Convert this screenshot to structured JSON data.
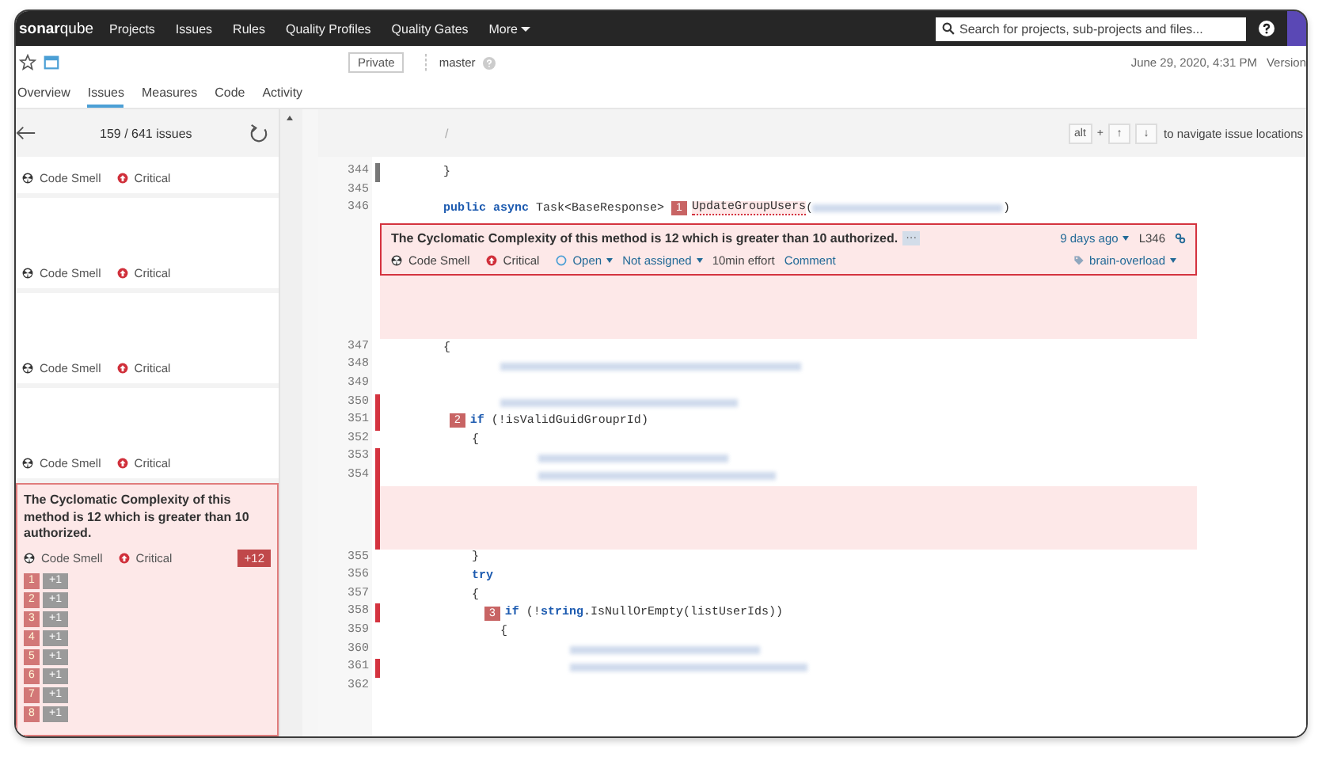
{
  "nav": {
    "logo": "**sonar**qube",
    "items": [
      "Projects",
      "Issues",
      "Rules",
      "Quality Profiles",
      "Quality Gates"
    ],
    "more": "More",
    "search_placeholder": "Search for projects, sub-projects and files..."
  },
  "project": {
    "visibility": "Private",
    "branch": "master",
    "date": "June 29, 2020, 4:31 PM",
    "version": "Version"
  },
  "tabs": [
    {
      "label": "Overview",
      "selected": false
    },
    {
      "label": "Issues",
      "selected": true
    },
    {
      "label": "Measures",
      "selected": false
    },
    {
      "label": "Code",
      "selected": false
    },
    {
      "label": "Activity",
      "selected": false
    }
  ],
  "issues_panel": {
    "count": "159 / 641 issues",
    "issues": [
      {
        "type": "Code Smell",
        "severity": "Critical",
        "selected": false
      },
      {
        "type": "Code Smell",
        "severity": "Critical",
        "selected": false
      },
      {
        "type": "Code Smell",
        "severity": "Critical",
        "selected": false
      },
      {
        "type": "Code Smell",
        "severity": "Critical",
        "selected": false
      },
      {
        "type": "Code Smell",
        "severity": "Critical",
        "selected": true,
        "message": "The Cyclomatic Complexity of this method is 12 which is greater than 10 authorized.",
        "total": "+12",
        "locations": [
          {
            "index": "1",
            "value": "+1"
          },
          {
            "index": "2",
            "value": "+1"
          },
          {
            "index": "3",
            "value": "+1"
          },
          {
            "index": "4",
            "value": "+1"
          },
          {
            "index": "5",
            "value": "+1"
          },
          {
            "index": "6",
            "value": "+1"
          },
          {
            "index": "7",
            "value": "+1"
          },
          {
            "index": "8",
            "value": "+1"
          }
        ]
      }
    ]
  },
  "code_viewer": {
    "path": "/",
    "keys": [
      "alt",
      "+",
      "↑",
      "↓"
    ],
    "hint": "to navigate issue locations",
    "lines": [
      {
        "kind": "code",
        "number": "344",
        "changed": true,
        "flagged": false,
        "tokens": [
          {
            "kind": "plain",
            "t": "        }"
          }
        ]
      },
      {
        "kind": "code",
        "number": "345",
        "changed": false,
        "flagged": false
      },
      {
        "kind": "code",
        "number": "346",
        "changed": false,
        "flagged": false,
        "tokens": [
          {
            "kind": "keyword",
            "t": "        public async"
          },
          {
            "kind": "plain",
            "t": " Task<BaseResponse> "
          },
          {
            "kind": "location",
            "t": "1"
          },
          {
            "kind": "issue",
            "t": "UpdateGroupUsers"
          },
          {
            "kind": "plain",
            "t": "("
          },
          {
            "kind": "blur"
          },
          {
            "kind": "plain",
            "t": ")"
          }
        ]
      },
      {
        "kind": "issue",
        "message": "The Cyclomatic Complexity of this method is 12 which is greater than 10 authorized.",
        "more": "···",
        "age": "9 days ago",
        "line": "L346",
        "type": "Code Smell",
        "severity": "Critical",
        "status": "Open",
        "assignee": "Not assigned",
        "effort": "10min effort",
        "comment": "Comment",
        "tag": "brain-overload"
      },
      {
        "kind": "gap",
        "flagged": false
      },
      {
        "kind": "code",
        "number": "347",
        "changed": false,
        "flagged": false,
        "tokens": [
          {
            "kind": "plain",
            "t": "        {"
          }
        ]
      },
      {
        "kind": "blurred",
        "number": "348",
        "changed": false,
        "flagged": false
      },
      {
        "kind": "code",
        "number": "349",
        "changed": false,
        "flagged": false
      },
      {
        "kind": "blurred",
        "number": "350",
        "changed": false,
        "flagged": true
      },
      {
        "kind": "code",
        "number": "351",
        "changed": false,
        "flagged": true,
        "tokens": [
          {
            "kind": "location",
            "t": "2"
          },
          {
            "kind": "keyword",
            "t": "if"
          },
          {
            "kind": "plain",
            "t": " (!isValidGuidGrouprId)"
          }
        ]
      },
      {
        "kind": "code",
        "number": "352",
        "changed": false,
        "flagged": false,
        "tokens": [
          {
            "kind": "plain",
            "t": "            {"
          }
        ]
      },
      {
        "kind": "blurred",
        "number": "353",
        "changed": false,
        "flagged": true
      },
      {
        "kind": "blurred",
        "number": "354",
        "changed": false,
        "flagged": true
      },
      {
        "kind": "gap",
        "flagged": true
      },
      {
        "kind": "code",
        "number": "355",
        "changed": false,
        "flagged": false,
        "tokens": [
          {
            "kind": "plain",
            "t": "            }"
          }
        ]
      },
      {
        "kind": "code",
        "number": "356",
        "changed": false,
        "flagged": false,
        "tokens": [
          {
            "kind": "keyword",
            "t": "            try"
          }
        ]
      },
      {
        "kind": "code",
        "number": "357",
        "changed": false,
        "flagged": false,
        "tokens": [
          {
            "kind": "plain",
            "t": "            {"
          }
        ]
      },
      {
        "kind": "code",
        "number": "358",
        "changed": false,
        "flagged": true,
        "tokens": [
          {
            "kind": "location",
            "t": "3"
          },
          {
            "kind": "keyword",
            "t": "if"
          },
          {
            "kind": "plain",
            "t": " (!"
          },
          {
            "kind": "keyword",
            "t": "string"
          },
          {
            "kind": "plain",
            "t": ".IsNullOrEmpty(listUserIds))"
          }
        ]
      },
      {
        "kind": "code",
        "number": "359",
        "changed": false,
        "flagged": false,
        "tokens": [
          {
            "kind": "plain",
            "t": "                {"
          }
        ]
      },
      {
        "kind": "blurred",
        "number": "360",
        "changed": false,
        "flagged": false
      },
      {
        "kind": "blurred",
        "number": "361",
        "changed": false,
        "flagged": true
      },
      {
        "kind": "code",
        "number": "362",
        "changed": false,
        "flagged": false
      }
    ]
  }
}
